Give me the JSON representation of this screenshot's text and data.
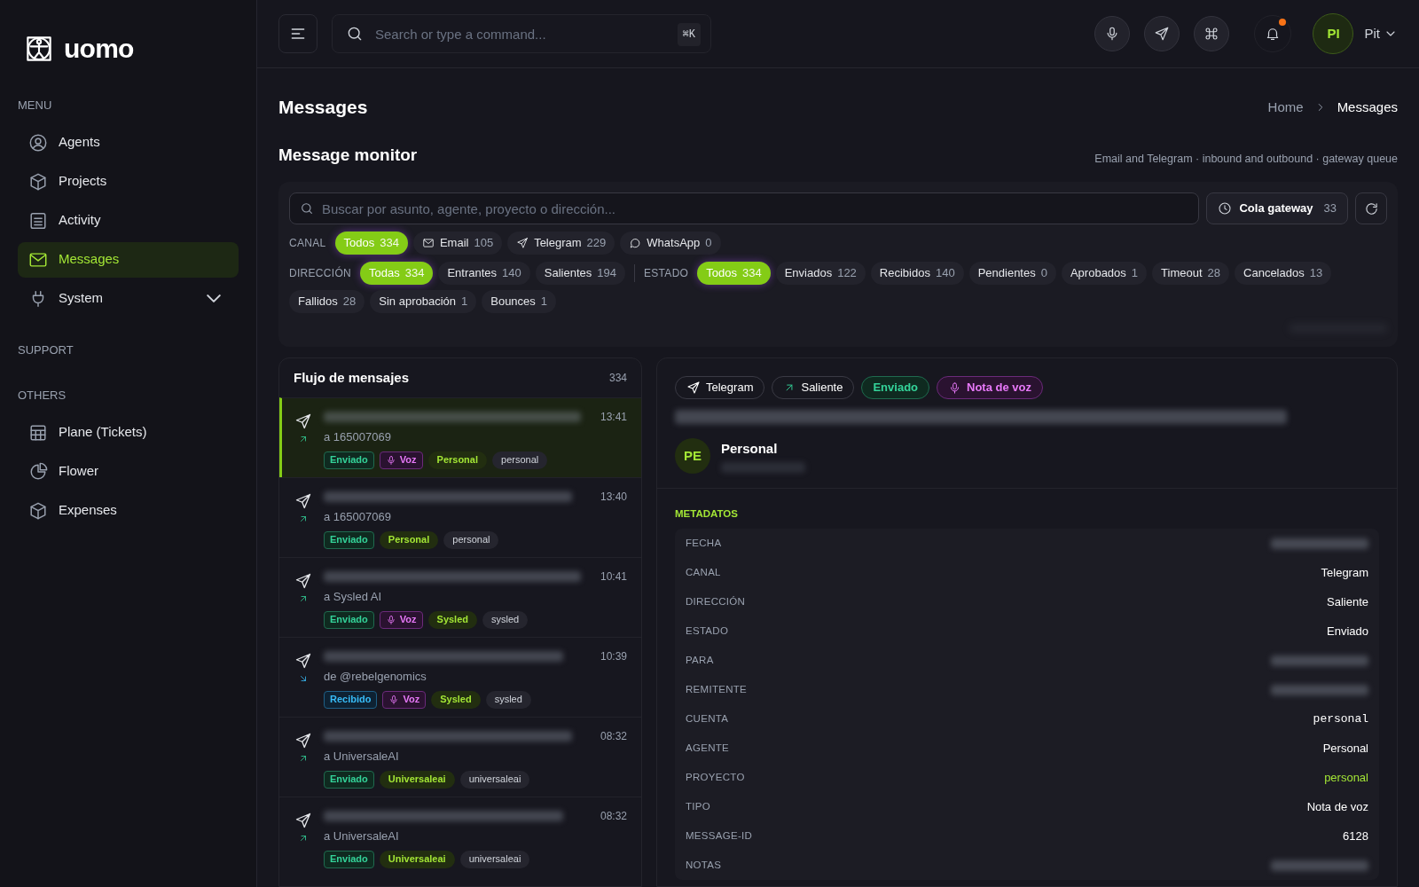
{
  "brand": {
    "name": "uomo"
  },
  "sidebar": {
    "sections": [
      {
        "title": "MENU",
        "items": [
          {
            "label": "Agents",
            "kind": "user",
            "selected": false
          },
          {
            "label": "Projects",
            "kind": "cube",
            "selected": false
          },
          {
            "label": "Activity",
            "kind": "list",
            "selected": false
          },
          {
            "label": "Messages",
            "kind": "mail",
            "selected": true
          },
          {
            "label": "System",
            "kind": "plug",
            "selected": false,
            "expandable": true
          }
        ]
      },
      {
        "title": "SUPPORT"
      },
      {
        "title": "OTHERS",
        "items": [
          {
            "label": "Plane (Tickets)",
            "kind": "table",
            "selected": false
          },
          {
            "label": "Flower",
            "kind": "pie",
            "selected": false
          },
          {
            "label": "Expenses",
            "kind": "cube",
            "selected": false
          }
        ]
      }
    ]
  },
  "topbar": {
    "search_placeholder": "Search or type a command...",
    "shortcut": "⌘K",
    "user": {
      "initials": "PI",
      "name": "Pit"
    },
    "notification": true
  },
  "page": {
    "title": "Messages",
    "breadcrumb": [
      "Home",
      "Messages"
    ]
  },
  "monitor": {
    "title": "Message monitor",
    "subtitle": "Email and Telegram · inbound and outbound · gateway queue",
    "search_placeholder": "Buscar por asunto, agente, proyecto o dirección...",
    "queue_button": {
      "label": "Cola gateway",
      "count": "33"
    },
    "filters": [
      {
        "label": "CANAL",
        "chips": [
          {
            "label": "Todos",
            "count": "334",
            "kind": "all",
            "selected": true
          },
          {
            "label": "Email",
            "count": "105",
            "kind": "email",
            "selected": false
          },
          {
            "label": "Telegram",
            "count": "229",
            "kind": "telegram",
            "selected": false
          },
          {
            "label": "WhatsApp",
            "count": "0",
            "kind": "whatsapp",
            "selected": false
          }
        ]
      },
      {
        "label": "DIRECCIÓN",
        "chips": [
          {
            "label": "Todas",
            "count": "334",
            "kind": "all",
            "selected": true
          },
          {
            "label": "Entrantes",
            "count": "140",
            "kind": "plain",
            "selected": false
          },
          {
            "label": "Salientes",
            "count": "194",
            "kind": "plain",
            "selected": false
          }
        ]
      },
      {
        "label": "ESTADO",
        "chips": [
          {
            "label": "Todos",
            "count": "334",
            "kind": "all",
            "selected": true
          },
          {
            "label": "Enviados",
            "count": "122",
            "kind": "plain",
            "selected": false
          },
          {
            "label": "Recibidos",
            "count": "140",
            "kind": "plain",
            "selected": false
          },
          {
            "label": "Pendientes",
            "count": "0",
            "kind": "plain",
            "selected": false
          },
          {
            "label": "Aprobados",
            "count": "1",
            "kind": "plain",
            "selected": false
          },
          {
            "label": "Timeout",
            "count": "28",
            "kind": "plain",
            "selected": false
          },
          {
            "label": "Cancelados",
            "count": "13",
            "kind": "plain",
            "selected": false
          },
          {
            "label": "Fallidos",
            "count": "28",
            "kind": "plain",
            "selected": false
          },
          {
            "label": "Sin aprobación",
            "count": "1",
            "kind": "plain",
            "selected": false
          },
          {
            "label": "Bounces",
            "count": "1",
            "kind": "plain",
            "selected": false
          }
        ]
      }
    ]
  },
  "stream": {
    "title": "Flujo de mensajes",
    "count": "334",
    "messages": [
      {
        "time": "13:41",
        "party": "a 165007069",
        "kind": "outbound",
        "selected": true,
        "tags": [
          {
            "label": "Enviado",
            "kind": "sent"
          },
          {
            "label": "Voz",
            "kind": "voice"
          },
          {
            "label": "Personal",
            "kind": "agent"
          },
          {
            "label": "personal",
            "kind": "account"
          }
        ]
      },
      {
        "time": "13:40",
        "party": "a 165007069",
        "kind": "outbound",
        "selected": false,
        "tags": [
          {
            "label": "Enviado",
            "kind": "sent"
          },
          {
            "label": "Personal",
            "kind": "agent"
          },
          {
            "label": "personal",
            "kind": "account"
          }
        ]
      },
      {
        "time": "10:41",
        "party": "a Sysled AI",
        "kind": "outbound",
        "selected": false,
        "tags": [
          {
            "label": "Enviado",
            "kind": "sent"
          },
          {
            "label": "Voz",
            "kind": "voice"
          },
          {
            "label": "Sysled",
            "kind": "agent"
          },
          {
            "label": "sysled",
            "kind": "account"
          }
        ]
      },
      {
        "time": "10:39",
        "party": "de @rebelgenomics",
        "kind": "inbound",
        "selected": false,
        "tags": [
          {
            "label": "Recibido",
            "kind": "received"
          },
          {
            "label": "Voz",
            "kind": "voice"
          },
          {
            "label": "Sysled",
            "kind": "agent"
          },
          {
            "label": "sysled",
            "kind": "account"
          }
        ]
      },
      {
        "time": "08:32",
        "party": "a UniversaleAI",
        "kind": "outbound",
        "selected": false,
        "tags": [
          {
            "label": "Enviado",
            "kind": "sent"
          },
          {
            "label": "Universaleai",
            "kind": "agent"
          },
          {
            "label": "universaleai",
            "kind": "account"
          }
        ]
      },
      {
        "time": "08:32",
        "party": "a UniversaleAI",
        "kind": "outbound",
        "selected": false,
        "tags": [
          {
            "label": "Enviado",
            "kind": "sent"
          },
          {
            "label": "Universaleai",
            "kind": "agent"
          },
          {
            "label": "universaleai",
            "kind": "account"
          }
        ]
      }
    ]
  },
  "detail": {
    "tags": [
      {
        "label": "Telegram",
        "kind": "telegram"
      },
      {
        "label": "Saliente",
        "kind": "outbound"
      },
      {
        "label": "Enviado",
        "kind": "sent"
      },
      {
        "label": "Nota de voz",
        "kind": "voice"
      }
    ],
    "sender": {
      "initials": "PE",
      "name": "Personal"
    },
    "metadata_title": "METADATOS",
    "metadata": [
      {
        "label": "FECHA",
        "kind": "blurred"
      },
      {
        "label": "CANAL",
        "value": "Telegram",
        "kind": "text"
      },
      {
        "label": "DIRECCIÓN",
        "value": "Saliente",
        "kind": "text"
      },
      {
        "label": "ESTADO",
        "value": "Enviado",
        "kind": "text"
      },
      {
        "label": "PARA",
        "kind": "blurred"
      },
      {
        "label": "REMITENTE",
        "kind": "blurred"
      },
      {
        "label": "CUENTA",
        "value": "personal",
        "kind": "mono"
      },
      {
        "label": "AGENTE",
        "value": "Personal",
        "kind": "text"
      },
      {
        "label": "PROYECTO",
        "value": "personal",
        "kind": "link"
      },
      {
        "label": "TIPO",
        "value": "Nota de voz",
        "kind": "text"
      },
      {
        "label": "MESSAGE-ID",
        "value": "6128",
        "kind": "text"
      },
      {
        "label": "NOTAS",
        "kind": "blurred"
      }
    ]
  }
}
